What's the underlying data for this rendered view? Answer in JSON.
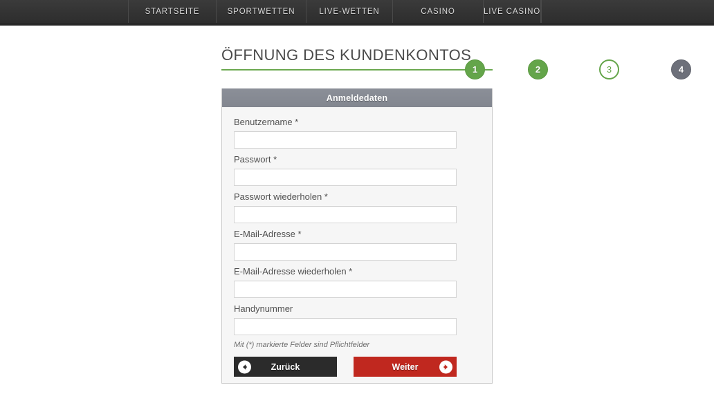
{
  "nav": {
    "items": [
      {
        "label": "STARTSEITE"
      },
      {
        "label": "SPORTWETTEN"
      },
      {
        "label": "LIVE-WETTEN"
      },
      {
        "label": "CASINO"
      },
      {
        "label": "LIVE CASINO"
      }
    ]
  },
  "page": {
    "title": "ÖFFNUNG DES KUNDENKONTOS"
  },
  "steps": {
    "items": [
      {
        "number": "1",
        "state": "done"
      },
      {
        "number": "2",
        "state": "done"
      },
      {
        "number": "3",
        "state": "active"
      },
      {
        "number": "4",
        "state": "pending"
      }
    ]
  },
  "form": {
    "header": "Anmeldedaten",
    "fields": [
      {
        "label": "Benutzername *",
        "value": "",
        "placeholder": ""
      },
      {
        "label": "Passwort *",
        "value": "",
        "placeholder": ""
      },
      {
        "label": "Passwort wiederholen *",
        "value": "",
        "placeholder": ""
      },
      {
        "label": "E-Mail-Adresse *",
        "value": "",
        "placeholder": ""
      },
      {
        "label": "E-Mail-Adresse wiederholen *",
        "value": "",
        "placeholder": ""
      },
      {
        "label": "Handynummer",
        "value": "",
        "placeholder": ""
      }
    ],
    "note": "Mit (*) markierte Felder sind Pflichtfelder",
    "back_button": "Zurück",
    "next_button": "Weiter"
  },
  "colors": {
    "nav_background": "#333333",
    "step_done": "#64a54a",
    "step_pending": "#6d707a",
    "panel_header": "#82868f",
    "panel_background": "#f6f6f6",
    "back_button": "#2b2b2b",
    "next_button": "#c0281f"
  }
}
